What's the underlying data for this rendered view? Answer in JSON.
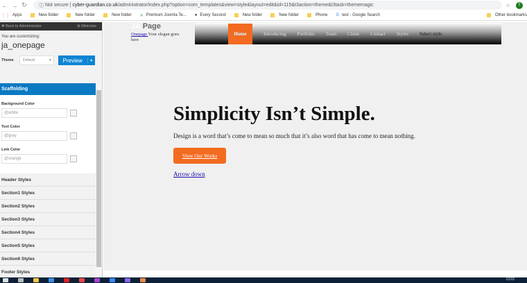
{
  "browser": {
    "security": "Not secure",
    "url_domain": "cyber-guardian.co.uk",
    "url_path": "/administrator/index.php?option=com_templates&view=style&layout=edit&id=115&t3action=theme&t3task=thememagic",
    "avatar": "T"
  },
  "bookmarks": [
    "Apps",
    "New folder",
    "New folder",
    "New folder",
    "Premium Joomla Te...",
    "Every Second",
    "New folder",
    "New folder",
    "Phone",
    "test - Google Search",
    "Other bookmarks"
  ],
  "sidebar": {
    "back": "Back to Administrator",
    "minimize": "Minimize",
    "customizing": "You are customizing:",
    "template": "ja_onepage",
    "theme_label": "Theme",
    "theme_value": "Default",
    "preview": "Preview",
    "section": "Scaffolding",
    "fields": [
      {
        "label": "Background Color",
        "value": "@white"
      },
      {
        "label": "Text Color",
        "value": "@gray"
      },
      {
        "label": "Link Color",
        "value": "@orange"
      }
    ],
    "groups": [
      "Header Styles",
      "Section1 Styles",
      "Section2 Styles",
      "Section3 Styles",
      "Section4 Styles",
      "Section5 Styles",
      "Section6 Styles",
      "Footer Styles"
    ]
  },
  "site": {
    "logo_ja": "JA",
    "logo": "Page",
    "slogan_link": "Onepage ",
    "slogan": "Your slogan goes here",
    "nav": [
      "Home",
      "Introducing",
      "Portfolio",
      "Team",
      "Client",
      "Contact",
      "Styles"
    ],
    "select_style": "Select style.",
    "hero": "Simplicity Isn’t Simple.",
    "para": "Design is a word that’s come to mean so much that it’s also word that has come to mean nothing.",
    "button": "View Our Works",
    "arrow": "Arrow down"
  },
  "taskbar": {
    "time": "13:02"
  }
}
